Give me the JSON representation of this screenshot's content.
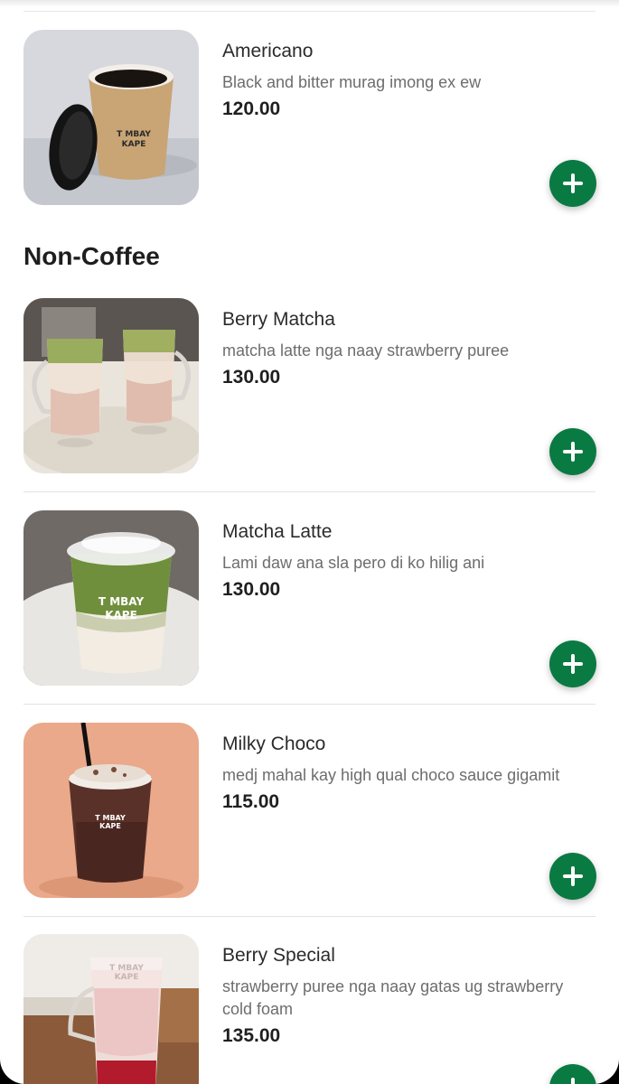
{
  "sections": {
    "non_coffee_title": "Non-Coffee"
  },
  "items": [
    {
      "name": "Americano",
      "description": "Black and bitter murag imong ex ew",
      "price": "120.00",
      "image": "americano-cup-photo"
    },
    {
      "name": "Berry Matcha",
      "description": "matcha latte nga naay strawberry puree",
      "price": "130.00",
      "image": "berry-matcha-glasses-photo"
    },
    {
      "name": "Matcha Latte",
      "description": "Lami daw ana sla pero di ko hilig ani",
      "price": "130.00",
      "image": "matcha-latte-cup-photo"
    },
    {
      "name": "Milky Choco",
      "description": "medj mahal kay high qual choco sauce gigamit",
      "price": "115.00",
      "image": "milky-choco-cup-photo"
    },
    {
      "name": "Berry Special",
      "description": "strawberry puree nga naay gatas ug strawberry cold foam",
      "price": "135.00",
      "image": "berry-special-glass-photo"
    }
  ],
  "cup_logo": {
    "line1": "T MBAY",
    "line2": "KAPE"
  },
  "colors": {
    "accent": "#0a7a43",
    "text": "#2b2b2b",
    "muted": "#6d6d6d",
    "divider": "#e3e3e3"
  },
  "icons": {
    "add": "plus-icon"
  }
}
